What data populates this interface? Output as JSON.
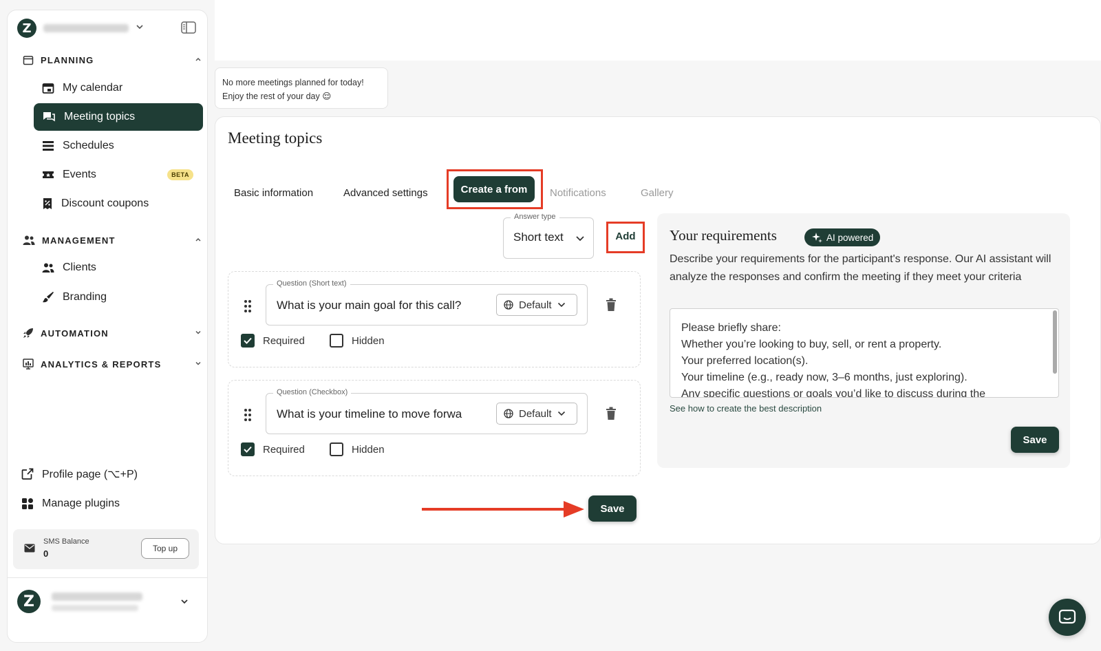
{
  "sidebar": {
    "sections": {
      "planning": "PLANNING",
      "management": "MANAGEMENT",
      "automation": "AUTOMATION",
      "analytics": "ANALYTICS & REPORTS"
    },
    "items": {
      "my_calendar": "My calendar",
      "meeting_topics": "Meeting topics",
      "schedules": "Schedules",
      "events": "Events",
      "events_badge": "BETA",
      "discount_coupons": "Discount coupons",
      "clients": "Clients",
      "branding": "Branding"
    },
    "bottom": {
      "profile_page": "Profile page (⌥+P)",
      "manage_plugins": "Manage plugins"
    },
    "sms": {
      "label": "SMS Balance",
      "value": "0",
      "topup": "Top up"
    }
  },
  "toast": {
    "line1": "No more meetings planned for today!",
    "line2": "Enjoy the rest of your day 😌"
  },
  "page": {
    "title": "Meeting topics",
    "tabs": {
      "basic": "Basic information",
      "advanced": "Advanced settings",
      "create_form": "Create a from",
      "notifications": "Notifications",
      "gallery": "Gallery"
    }
  },
  "form": {
    "answer_type_legend": "Answer type",
    "answer_type_value": "Short text",
    "add": "Add",
    "questions": [
      {
        "legend": "Question (Short text)",
        "text": "What is your main goal for this call?",
        "lang": "Default",
        "required": "Required",
        "hidden": "Hidden"
      },
      {
        "legend": "Question (Checkbox)",
        "text": "What is your timeline to move forwa",
        "lang": "Default",
        "required": "Required",
        "hidden": "Hidden"
      }
    ],
    "save": "Save"
  },
  "requirements": {
    "title": "Your requirements",
    "badge": "AI powered",
    "description": "Describe your requirements for the participant's response. Our AI assistant will analyze the responses and confirm the meeting if they meet your criteria",
    "lines": [
      "Please briefly share:",
      "Whether you’re looking to buy, sell, or rent a property.",
      "Your preferred location(s).",
      "Your timeline (e.g., ready now, 3–6 months, just exploring).",
      "Any specific questions or goals you’d like to discuss during the"
    ],
    "link": "See how to create the best description",
    "save": "Save"
  },
  "colors": {
    "brand": "#1f3d35",
    "highlight": "#e53c26"
  }
}
